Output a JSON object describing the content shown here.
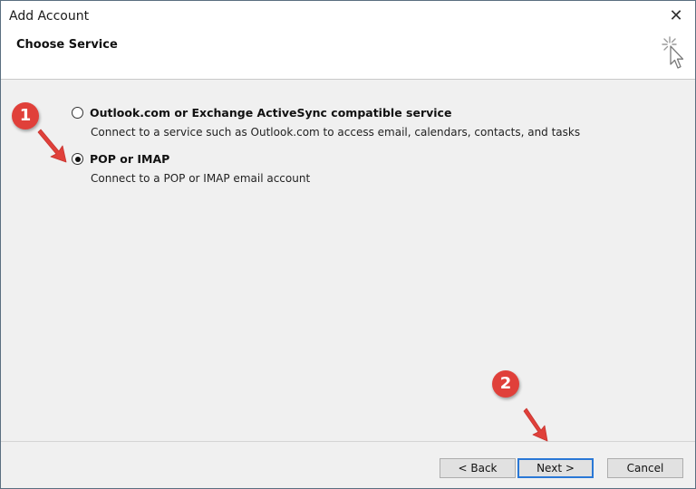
{
  "window": {
    "title": "Add Account",
    "close_glyph": "✕"
  },
  "header": {
    "subtitle": "Choose Service",
    "icon": "sparkle-cursor-icon"
  },
  "options": [
    {
      "label": "Outlook.com or Exchange ActiveSync compatible service",
      "description": "Connect to a service such as Outlook.com to access email, calendars, contacts, and tasks",
      "selected": false
    },
    {
      "label": "POP or IMAP",
      "description": "Connect to a POP or IMAP email account",
      "selected": true
    }
  ],
  "buttons": {
    "back": "< Back",
    "next": "Next >",
    "cancel": "Cancel"
  },
  "annotations": {
    "step1": "1",
    "step2": "2",
    "color": "#e0403a"
  }
}
